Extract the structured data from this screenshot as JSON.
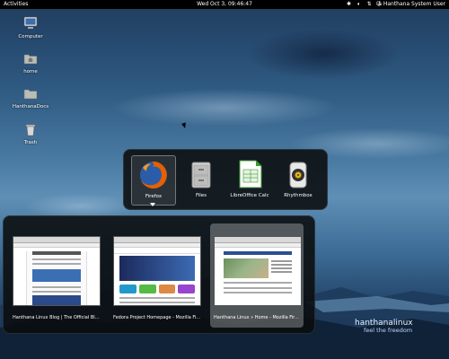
{
  "topbar": {
    "activities": "Activities",
    "clock": "Wed Oct  3, 09:46:47",
    "icons": [
      "bluetooth-icon",
      "volume-icon",
      "network-icon",
      "accessibility-icon"
    ],
    "user": "Hanthana System User"
  },
  "desktop": {
    "icons": [
      {
        "label": "Computer",
        "icon": "computer-icon"
      },
      {
        "label": "home",
        "icon": "home-folder-icon"
      },
      {
        "label": "HanthanaDocs",
        "icon": "folder-icon"
      },
      {
        "label": "Trash",
        "icon": "trash-icon"
      }
    ]
  },
  "switcher": {
    "apps": [
      {
        "label": "Firefox",
        "icon": "firefox-icon",
        "selected": true
      },
      {
        "label": "Files",
        "icon": "files-icon",
        "selected": false
      },
      {
        "label": "LibreOffice Calc",
        "icon": "calc-icon",
        "selected": false
      },
      {
        "label": "Rhythmbox",
        "icon": "rhythmbox-icon",
        "selected": false
      }
    ]
  },
  "windows": {
    "items": [
      {
        "title": "Hanthana Linux Blog | The Official Blog of...",
        "selected": false
      },
      {
        "title": "Fedora Project Homepage - Mozilla Firefox",
        "selected": false
      },
      {
        "title": "Hanthana Linux » Home - Mozilla Firefox",
        "selected": true
      }
    ]
  },
  "logo": {
    "name": "hanthanalinux",
    "tagline": "feel the freedom"
  },
  "colors": {
    "panel": "#000000",
    "switcher_bg": "#0a0c0e",
    "firefox_orange": "#e66000",
    "calc_green": "#3a9a2d"
  }
}
